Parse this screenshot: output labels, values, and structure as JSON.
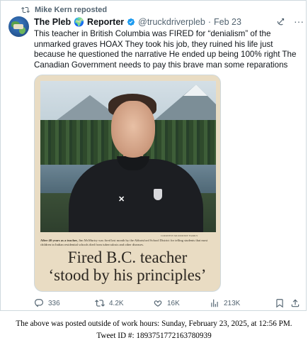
{
  "repost": {
    "icon": "repost-icon",
    "label": "Mike Kern reposted"
  },
  "author": {
    "avatar": "avatar",
    "name": "The Pleb",
    "globe": "🌍",
    "name_suffix": "Reporter",
    "verified_icon": "verified-badge-icon",
    "handle": "@truckdriverpleb",
    "separator": "·",
    "date": "Feb 23"
  },
  "tweet_text": "This teacher in British Columbia was FIRED for “denialism” of the unmarked graves HOAX They took his job, they ruined his life just because he questioned the narrative He ended up being 100% right The Canadian Government needs to pay this brave man some reparations",
  "media": {
    "photo_credit": "COURTESY MCMURTRY FAMILY",
    "caption_lead": "After 40 years as a teacher,",
    "caption_rest": " Jim McMurtry was fired last month by the Abbotsford School District for telling students that most children in Indian residential schools died from tuberculosis and other diseases.",
    "headline_line1": "Fired B.C. teacher",
    "headline_line2": "‘stood by his principles’"
  },
  "actions": {
    "replies": "336",
    "reposts": "4.2K",
    "likes": "16K",
    "views": "213K"
  },
  "footer": {
    "line1": "The above was posted outside of work hours: Sunday, February 23, 2025, at 12:56 PM.",
    "line2": "Tweet ID #: 1893751772163780939"
  },
  "colors": {
    "text": "#0f1419",
    "secondary": "#536471",
    "verified": "#1d9bf0",
    "border": "#cfd9de"
  }
}
